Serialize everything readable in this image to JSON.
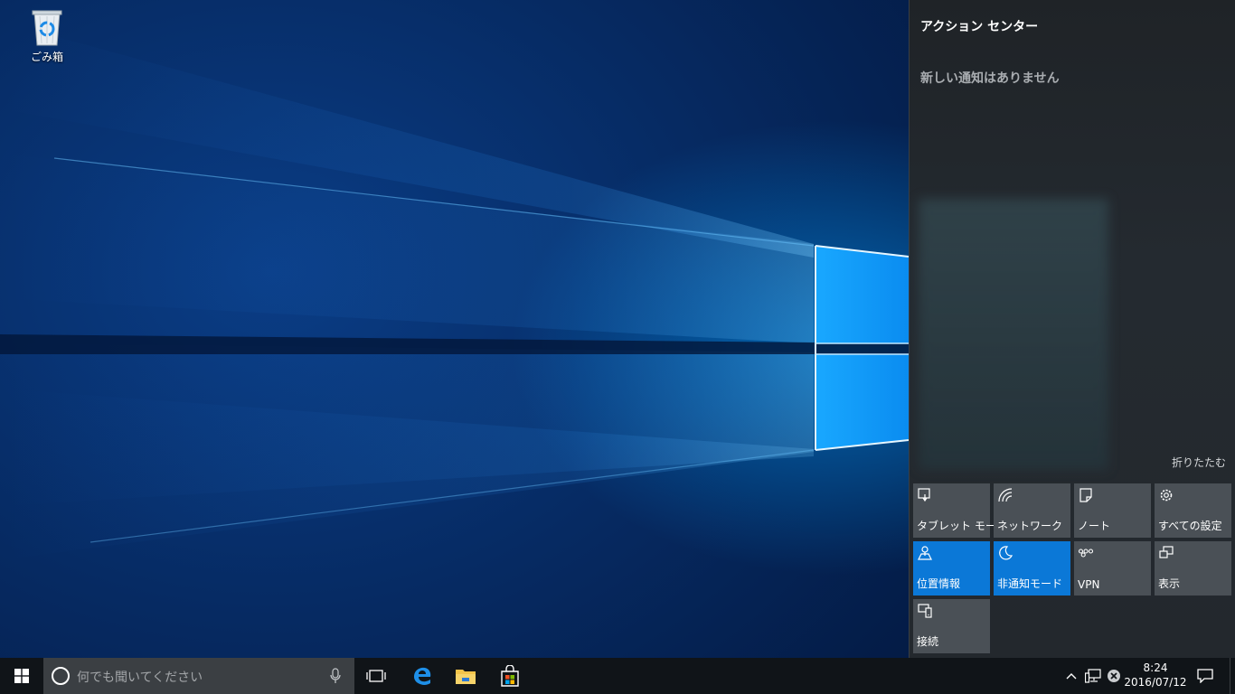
{
  "desktop": {
    "icons": [
      {
        "label": "ごみ箱",
        "icon": "recycle-bin-icon"
      }
    ]
  },
  "action_center": {
    "title": "アクション センター",
    "empty_message": "新しい通知はありません",
    "collapse_label": "折りたたむ",
    "quick_actions": [
      {
        "label": "タブレット モード",
        "icon": "tablet-mode-icon",
        "active": false
      },
      {
        "label": "ネットワーク",
        "icon": "network-icon",
        "active": false
      },
      {
        "label": "ノート",
        "icon": "note-icon",
        "active": false
      },
      {
        "label": "すべての設定",
        "icon": "gear-icon",
        "active": false
      },
      {
        "label": "位置情報",
        "icon": "location-icon",
        "active": true
      },
      {
        "label": "非通知モード",
        "icon": "moon-icon",
        "active": true
      },
      {
        "label": "VPN",
        "icon": "vpn-icon",
        "active": false
      },
      {
        "label": "表示",
        "icon": "project-icon",
        "active": false
      },
      {
        "label": "接続",
        "icon": "connect-icon",
        "active": false
      }
    ],
    "colors": {
      "tile": "#4a5056",
      "tile_active": "#0b78d7",
      "panel": "#23282d"
    }
  },
  "taskbar": {
    "search_placeholder": "何でも聞いてください",
    "apps": [
      "task-view-icon",
      "edge-icon",
      "file-explorer-icon",
      "store-icon"
    ],
    "tray": {
      "icons": [
        "chevron-up-icon",
        "network-icon",
        "volume-muted-icon"
      ],
      "time": "8:24",
      "date": "2016/07/12"
    }
  }
}
